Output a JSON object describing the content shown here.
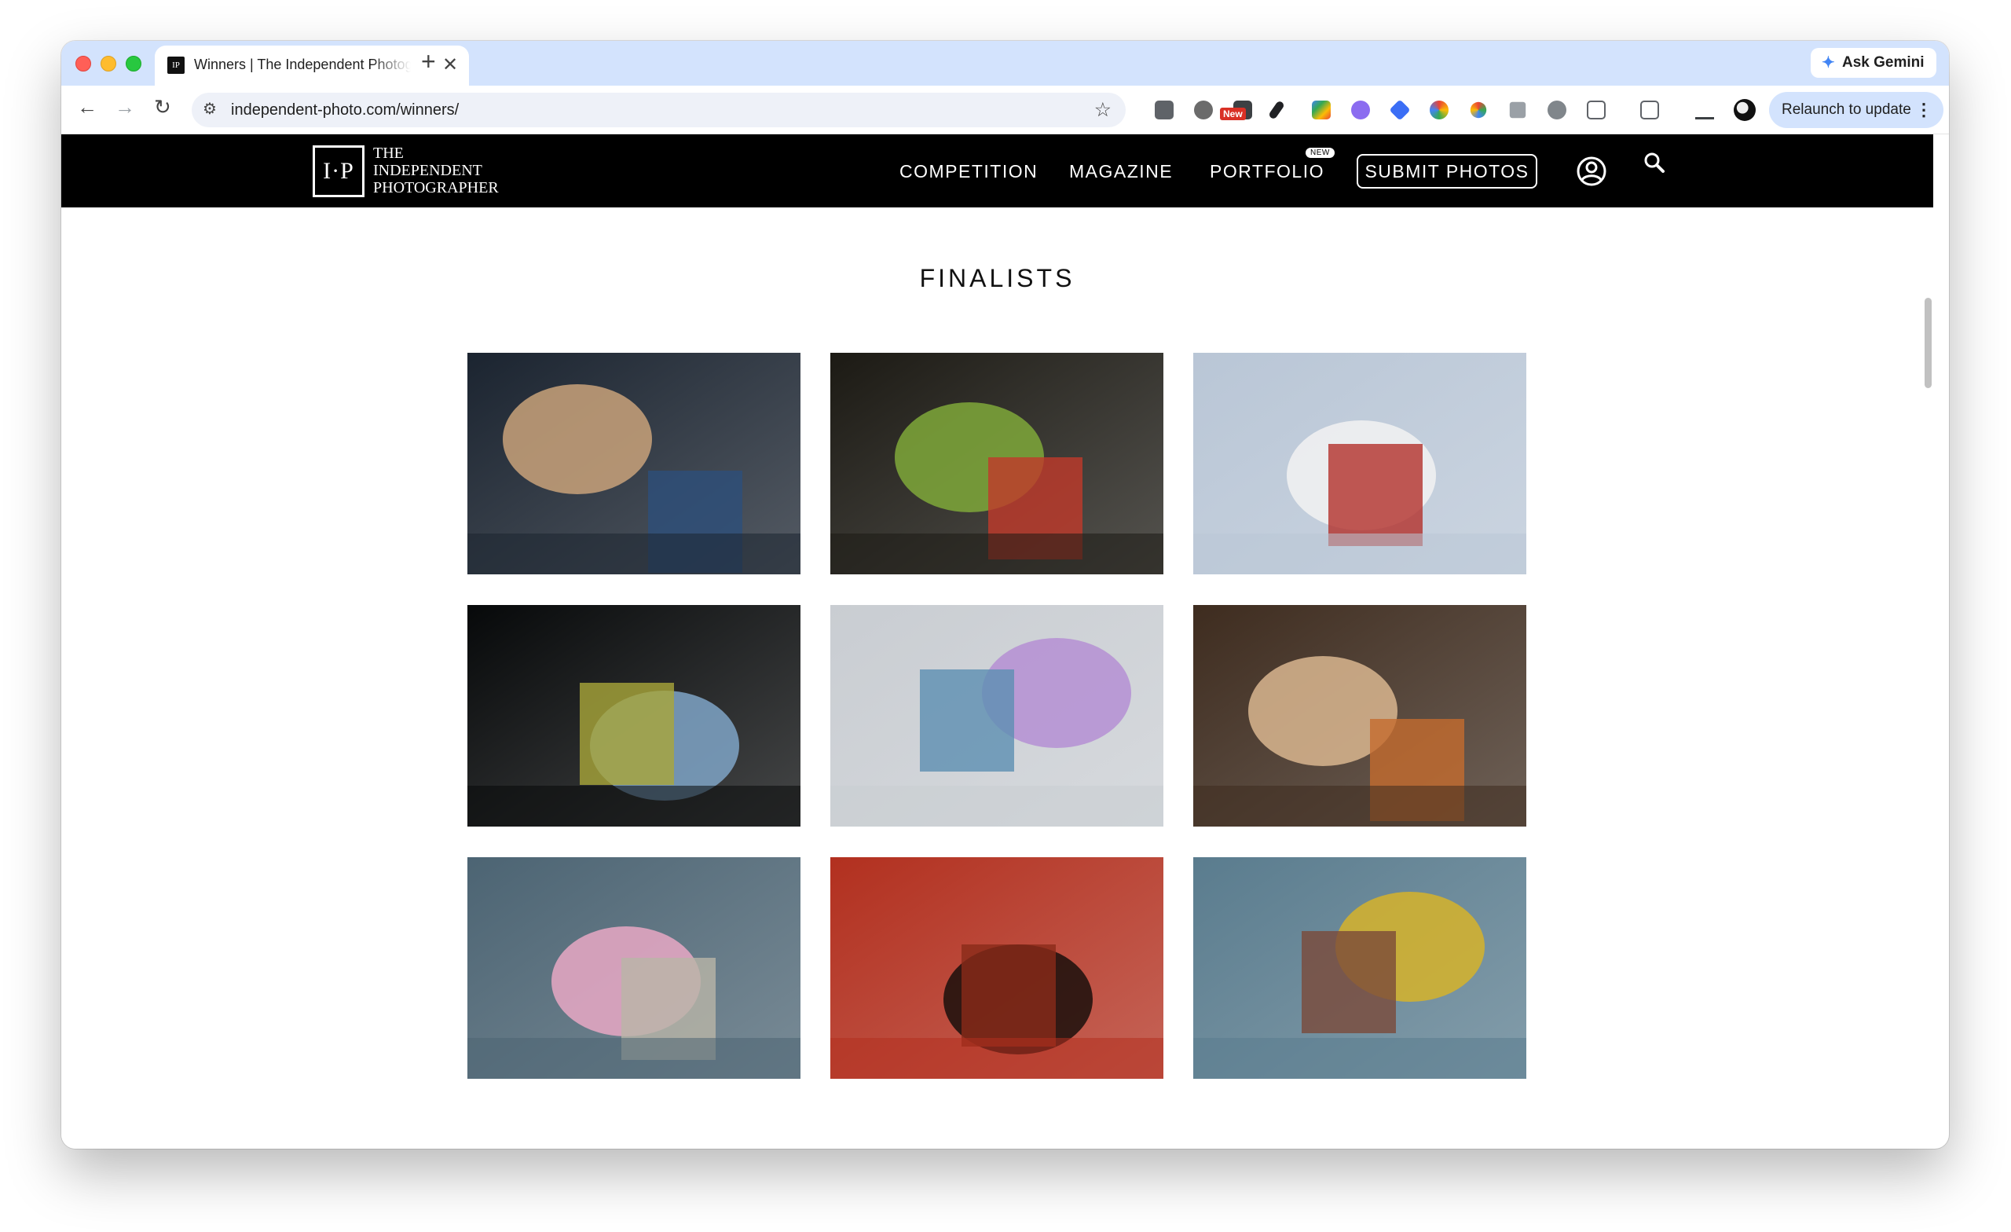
{
  "browser": {
    "tab_title": "Winners | The Independent Photographer",
    "tab_favicon": "IP",
    "new_tab_glyph": "+",
    "close_glyph": "✕",
    "gemini_label": "Ask Gemini",
    "url": "independent-photo.com/winners/",
    "ext_new_badge": "New",
    "relaunch_label": "Relaunch to update"
  },
  "site": {
    "logo_mark": "I·P",
    "logo_line1": "THE",
    "logo_line2": "INDEPENDENT",
    "logo_line3": "PHOTOGRAPHER",
    "nav": {
      "competition": "COMPETITION",
      "magazine": "MAGAZINE",
      "portfolio": "PORTFOLIO",
      "portfolio_badge": "NEW",
      "submit": "SUBMIT PHOTOS"
    }
  },
  "main": {
    "section_title": "FINALISTS",
    "photos": [
      {
        "name": "woman-with-fan",
        "colors": [
          "#1b2430",
          "#c9a27a",
          "#2d4f7a"
        ]
      },
      {
        "name": "playground-shadows",
        "colors": [
          "#1c1a14",
          "#7fa83a",
          "#c0392b"
        ]
      },
      {
        "name": "dog-and-birds",
        "colors": [
          "#b9c6d6",
          "#f2f2f2",
          "#b3302b"
        ]
      },
      {
        "name": "ferry-windows",
        "colors": [
          "#07090a",
          "#7fa4c7",
          "#a9a63a"
        ]
      },
      {
        "name": "children-playing-balloon",
        "colors": [
          "#c9cdd2",
          "#b58fd4",
          "#5d8fb2"
        ]
      },
      {
        "name": "arches-by-lake",
        "colors": [
          "#3e2c1f",
          "#d9b68f",
          "#c46b2e"
        ]
      },
      {
        "name": "street-hula-hoop",
        "colors": [
          "#4c6473",
          "#e8a8c4",
          "#b9b5a8"
        ]
      },
      {
        "name": "red-wall-shadows",
        "colors": [
          "#b2301f",
          "#1a0f0c",
          "#8a2b19"
        ]
      },
      {
        "name": "rickshaw-boy",
        "colors": [
          "#5a7c8e",
          "#d6b32a",
          "#7b4a3a"
        ]
      }
    ]
  },
  "icons": [
    "back-arrow-icon",
    "forward-arrow-icon",
    "reload-icon",
    "site-info-icon",
    "star-icon",
    "user-icon",
    "search-icon",
    "gemini-sparkle-icon",
    "more-vert-icon"
  ]
}
